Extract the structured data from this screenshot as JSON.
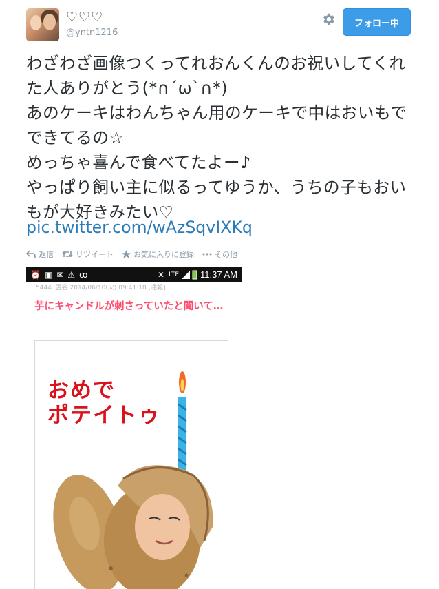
{
  "user": {
    "name": "♡♡♡",
    "handle": "@yntn1216"
  },
  "follow_button": {
    "label": "フォロー中"
  },
  "tweet": {
    "text": "わざわざ画像つくってれおんくんのお祝いしてくれた人ありがとう(*∩´ω`∩*)\nあのケーキはわんちゃん用のケーキで中はおいもでできてるの☆\nめっちゃ喜んで食べてたよー♪\nやっぱり飼い主に似るってゆうか、うちの子もおいもが大好きみたい♡",
    "link": "pic.twitter.com/wAzSqvIXKq"
  },
  "actions": [
    {
      "label": "返信",
      "icon": "reply-icon"
    },
    {
      "label": "リツイート",
      "icon": "retweet-icon"
    },
    {
      "label": "お気に入りに登録",
      "icon": "star-icon"
    },
    {
      "label": "その他",
      "icon": "more-icon"
    }
  ],
  "media": {
    "status_time": "11:37 AM",
    "status_network": "LTE",
    "post_meta": "5444. 匿名 2014/06/10(火) 09:41:18 [通報]",
    "caption": "芋にキャンドルが刺さっていたと聞いて…",
    "card_text_line1": "おめで",
    "card_text_line2": "ポテイトゥ"
  },
  "colors": {
    "follow_bg": "#3d9ce8",
    "link": "#2b7bb9",
    "caption": "#ff4d6d",
    "card_title": "#d9121b"
  }
}
